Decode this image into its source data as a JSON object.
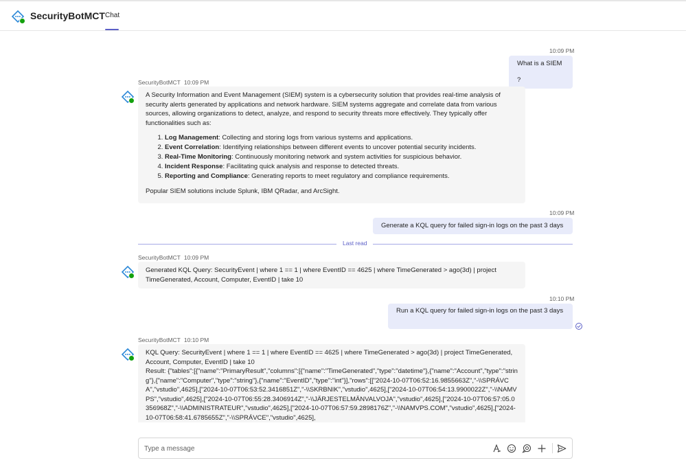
{
  "app": {
    "title": "SecurityBotMCT",
    "tab_label": "Chat",
    "accent_color": "#5b5fc7",
    "presence_color": "#13a10e"
  },
  "messages": {
    "user1": {
      "time": "10:09 PM",
      "text": "What is a SIEM ?"
    },
    "bot1": {
      "sender": "SecurityBotMCT",
      "time": "10:09 PM",
      "intro": "A Security Information and Event Management (SIEM) system is a cybersecurity solution that provides real-time analysis of security alerts generated by applications and network hardware. SIEM systems aggregate and correlate data from various sources, allowing organizations to detect, analyze, and respond to security threats more effectively. They typically offer functionalities such as:",
      "items": [
        {
          "title": "Log Management",
          "desc": ": Collecting and storing logs from various systems and applications."
        },
        {
          "title": "Event Correlation",
          "desc": ": Identifying relationships between different events to uncover potential security incidents."
        },
        {
          "title": "Real-Time Monitoring",
          "desc": ": Continuously monitoring network and system activities for suspicious behavior."
        },
        {
          "title": "Incident Response",
          "desc": ": Facilitating quick analysis and response to detected threats."
        },
        {
          "title": "Reporting and Compliance",
          "desc": ": Generating reports to meet regulatory and compliance requirements."
        }
      ],
      "outro": "Popular SIEM solutions include Splunk, IBM QRadar, and ArcSight."
    },
    "user2": {
      "time": "10:09 PM",
      "text": "Generate a KQL query for failed sign-in logs on the past 3 days"
    },
    "last_read_label": "Last read",
    "bot2": {
      "sender": "SecurityBotMCT",
      "time": "10:09 PM",
      "text": "Generated KQL Query: SecurityEvent | where 1 == 1 | where EventID == 4625 | where TimeGenerated > ago(3d) | project TimeGenerated, Account, Computer, EventID | take 10"
    },
    "user3": {
      "time": "10:10 PM",
      "text": "Run a KQL query for failed sign-in logs on the past 3 days"
    },
    "bot3": {
      "sender": "SecurityBotMCT",
      "time": "10:10 PM",
      "query": "KQL Query: SecurityEvent | where 1 == 1 | where EventID == 4625 | where TimeGenerated > ago(3d) | project TimeGenerated, Account, Computer, EventID | take 10",
      "result": "Result: {\"tables\":[{\"name\":\"PrimaryResult\",\"columns\":[{\"name\":\"TimeGenerated\",\"type\":\"datetime\"},{\"name\":\"Account\",\"type\":\"string\"},{\"name\":\"Computer\",\"type\":\"string\"},{\"name\":\"EventID\",\"type\":\"int\"}],\"rows\":[[\"2024-10-07T06:52:16.9855663Z\",\"-\\\\SPRÁVCA\",\"vstudio\",4625],[\"2024-10-07T06:53:52.3416851Z\",\"-\\\\SKRBNIK\",\"vstudio\",4625],[\"2024-10-07T06:54:13.9900022Z\",\"-\\\\NAMVPS\",\"vstudio\",4625],[\"2024-10-07T06:55:28.3406914Z\",\"-\\\\JÄRJESTELMÄNVALVOJA\",\"vstudio\",4625],[\"2024-10-07T06:57:05.0356968Z\",\"-\\\\ADMINISTRATEUR\",\"vstudio\",4625],[\"2024-10-07T06:57:59.2898176Z\",\"-\\\\NAMVPS.COM\",\"vstudio\",4625],[\"2024-10-07T06:58:41.6785655Z\",\"-\\\\SPRÁVCE\",\"vstudio\",4625],"
    }
  },
  "compose": {
    "placeholder": "Type a message"
  },
  "icons": [
    "bot-icon",
    "format-icon",
    "emoji-icon",
    "loop-icon",
    "plus-icon",
    "send-icon",
    "read-receipt-icon"
  ]
}
